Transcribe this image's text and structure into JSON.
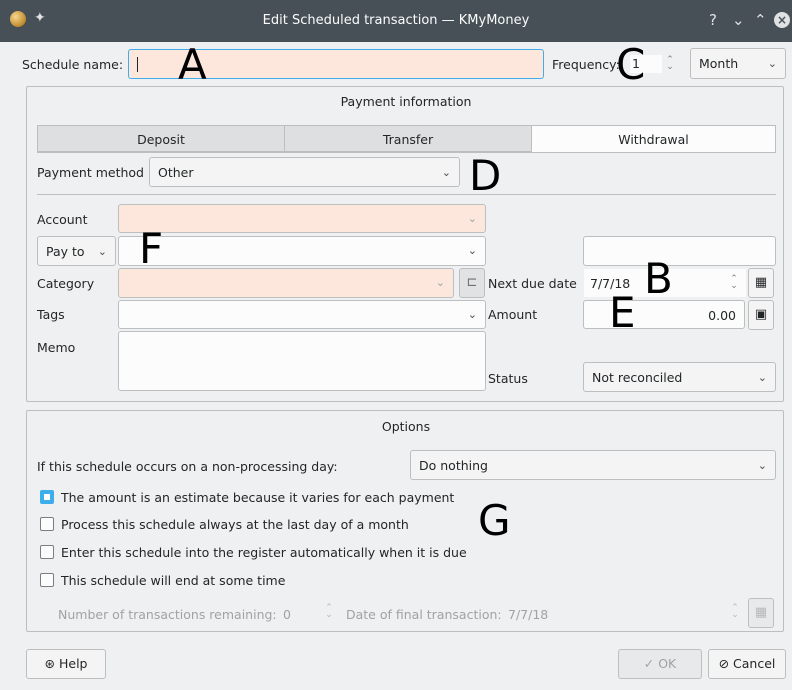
{
  "window": {
    "title": "Edit Scheduled transaction — KMyMoney",
    "help_btn": "?",
    "min_btn": "⌄",
    "max_btn": "⌃",
    "close_btn": "×"
  },
  "header": {
    "schedule_name_label": "Schedule name:",
    "schedule_name_value": "",
    "frequency_label": "Frequency:",
    "frequency_value": "1",
    "frequency_unit": "Month"
  },
  "payment": {
    "section_title": "Payment information",
    "tabs": [
      "Deposit",
      "Transfer",
      "Withdrawal"
    ],
    "active_tab": "Withdrawal",
    "method_label": "Payment method",
    "method_value": "Other",
    "account_label": "Account",
    "payto_label": "Pay to",
    "category_label": "Category",
    "tags_label": "Tags",
    "memo_label": "Memo",
    "next_due_label": "Next due date",
    "next_due_value": "7/7/18",
    "amount_label": "Amount",
    "amount_value": "0.00",
    "status_label": "Status",
    "status_value": "Not reconciled"
  },
  "options": {
    "section_title": "Options",
    "nonprocessing_label": "If this schedule occurs on a non-processing day:",
    "nonprocessing_value": "Do nothing",
    "checks": [
      {
        "label": "The amount is an estimate because it varies for each payment",
        "checked": true
      },
      {
        "label": "Process this schedule always at the last day of a month",
        "checked": false
      },
      {
        "label": "Enter this schedule into the register automatically when it is due",
        "checked": false
      },
      {
        "label": "This schedule will end at some time",
        "checked": false
      }
    ],
    "remaining_label": "Number of transactions remaining:",
    "remaining_value": "0",
    "final_date_label": "Date of final transaction:",
    "final_date_value": "7/7/18"
  },
  "footer": {
    "help": "Help",
    "ok": "OK",
    "cancel": "Cancel"
  },
  "annotations": {
    "A": "A",
    "B": "B",
    "C": "C",
    "D": "D",
    "E": "E",
    "F": "F",
    "G": "G"
  }
}
